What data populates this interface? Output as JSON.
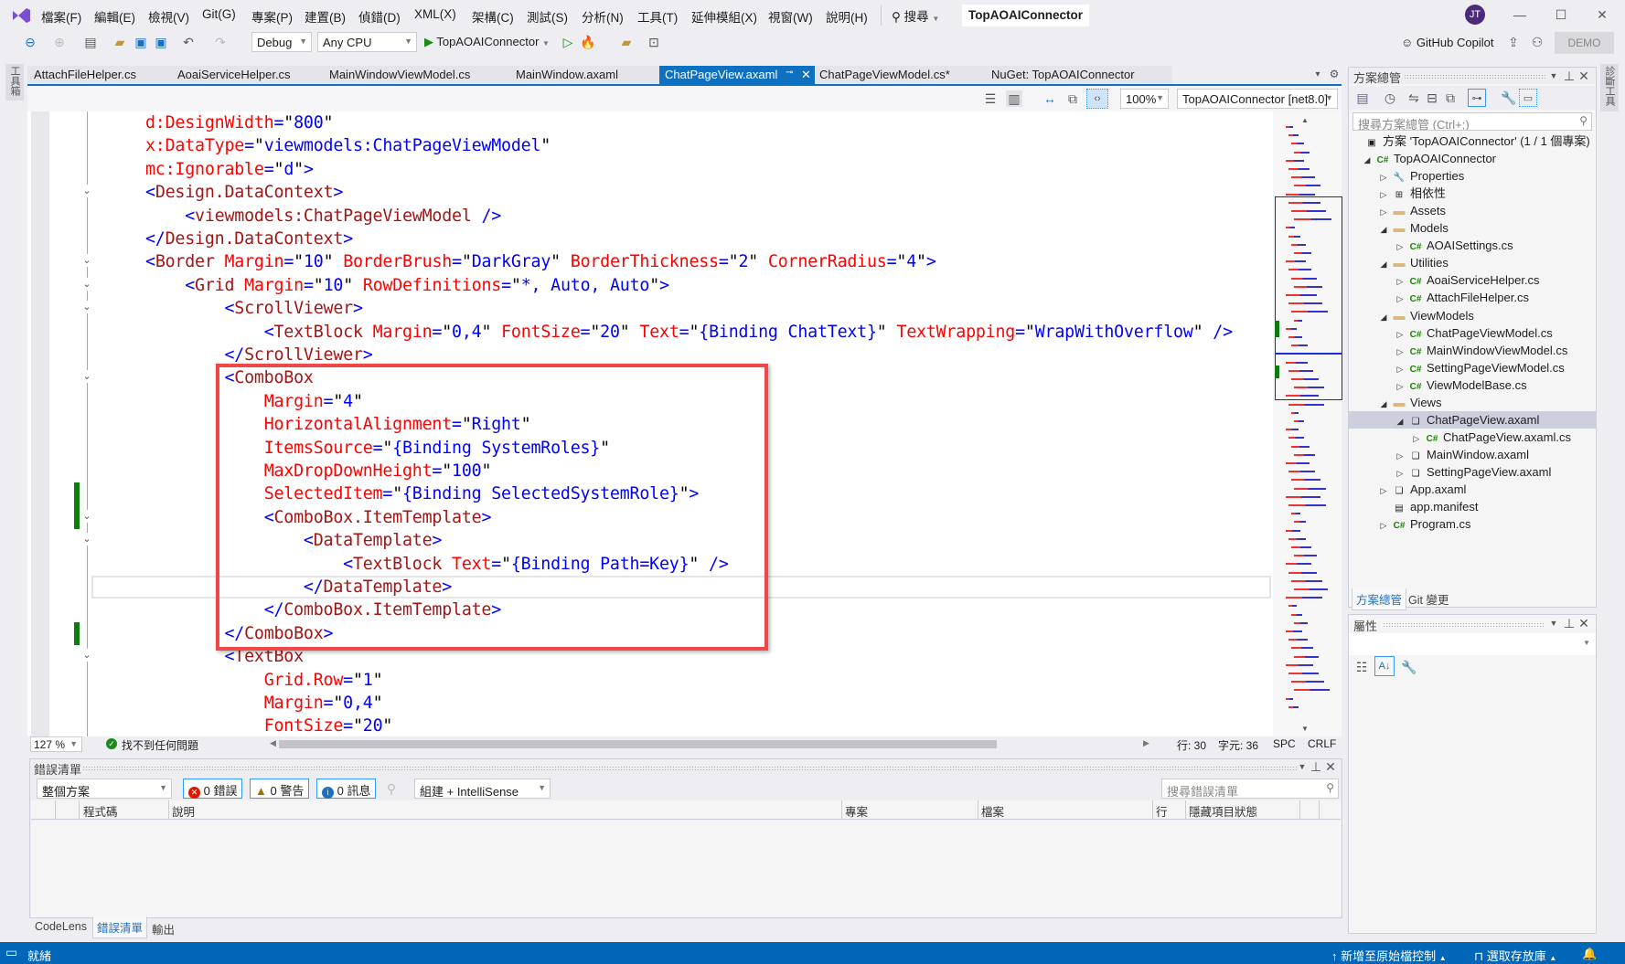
{
  "menu": {
    "items": [
      "檔案(F)",
      "編輯(E)",
      "檢視(V)",
      "Git(G)",
      "專案(P)",
      "建置(B)",
      "偵錯(D)",
      "XML(X)",
      "架構(C)",
      "測試(S)",
      "分析(N)",
      "工具(T)",
      "延伸模組(X)",
      "視窗(W)",
      "說明(H)"
    ],
    "search_label": "搜尋",
    "window_title": "TopAOAIConnector",
    "avatar_initials": "JT"
  },
  "toolbar": {
    "configuration": "Debug",
    "platform": "Any CPU",
    "startup_project": "TopAOAIConnector",
    "copilot_label": "GitHub Copilot",
    "demo_label": "DEMO"
  },
  "left_strip": {
    "label": "工具箱"
  },
  "right_strip": {
    "label": "診斷工具"
  },
  "tabs": [
    {
      "label": "AttachFileHelper.cs",
      "active": false
    },
    {
      "label": "AoaiServiceHelper.cs",
      "active": false
    },
    {
      "label": "MainWindowViewModel.cs",
      "active": false
    },
    {
      "label": "MainWindow.axaml",
      "active": false
    },
    {
      "label": "ChatPageView.axaml",
      "active": true
    },
    {
      "label": "ChatPageViewModel.cs*",
      "active": false
    },
    {
      "label": "NuGet: TopAOAIConnector",
      "active": false
    }
  ],
  "editor": {
    "zoom_select": "100%",
    "target_framework": "TopAOAIConnector [net8.0]",
    "lines": [
      {
        "text": "d:DesignWidth=\"800\""
      },
      {
        "text": "x:DataType=\"viewmodels:ChatPageViewModel\""
      },
      {
        "text": "mc:Ignorable=\"d\">"
      },
      {
        "text": "<Design.DataContext>",
        "fold": true
      },
      {
        "text": "    <viewmodels:ChatPageViewModel />"
      },
      {
        "text": "</Design.DataContext>"
      },
      {
        "text": "<Border Margin=\"10\" BorderBrush=\"DarkGray\" BorderThickness=\"2\" CornerRadius=\"4\">",
        "fold": true
      },
      {
        "text": "    <Grid Margin=\"10\" RowDefinitions=\"*, Auto, Auto\">",
        "fold": true
      },
      {
        "text": "        <ScrollViewer>",
        "fold": true
      },
      {
        "text": "            <TextBlock Margin=\"0,4\" FontSize=\"20\" Text=\"{Binding ChatText}\" TextWrapping=\"WrapWithOverflow\" />"
      },
      {
        "text": "        </ScrollViewer>"
      },
      {
        "text": "        <ComboBox",
        "fold": true
      },
      {
        "text": "            Margin=\"4\""
      },
      {
        "text": "            HorizontalAlignment=\"Right\""
      },
      {
        "text": "            ItemsSource=\"{Binding SystemRoles}\""
      },
      {
        "text": "            MaxDropDownHeight=\"100\""
      },
      {
        "text": "            SelectedItem=\"{Binding SelectedSystemRole}\">",
        "changed": true
      },
      {
        "text": "            <ComboBox.ItemTemplate>",
        "fold": true,
        "changed": true
      },
      {
        "text": "                <DataTemplate>",
        "fold": true
      },
      {
        "text": "                    <TextBlock Text=\"{Binding Path=Key}\" />"
      },
      {
        "text": "                </DataTemplate>",
        "current": true
      },
      {
        "text": "            </ComboBox.ItemTemplate>"
      },
      {
        "text": "        </ComboBox>",
        "changed": true
      },
      {
        "text": "        <TextBox",
        "fold": true
      },
      {
        "text": "            Grid.Row=\"1\""
      },
      {
        "text": "            Margin=\"0,4\""
      },
      {
        "text": "            FontSize=\"20\""
      }
    ],
    "status": {
      "zoom": "127 %",
      "issues": "找不到任何問題",
      "line": "行: 30",
      "char": "字元: 36",
      "spacing": "SPC",
      "eol": "CRLF"
    },
    "highlight_color": "#f04848"
  },
  "error_list": {
    "title": "錯誤清單",
    "scope": "整個方案",
    "errors": "0 錯誤",
    "warnings": "0 警告",
    "messages": "0 訊息",
    "source": "組建 + IntelliSense",
    "search_placeholder": "搜尋錯誤清單",
    "columns": [
      "程式碼",
      "說明",
      "專案",
      "檔案",
      "行",
      "隱藏項目狀態"
    ],
    "bottom_tabs": [
      "CodeLens",
      "錯誤清單",
      "輸出"
    ]
  },
  "solution_explorer": {
    "title": "方案總管",
    "search_placeholder": "搜尋方案總管 (Ctrl+;)",
    "items": [
      {
        "label": "方案 'TopAOAIConnector' (1 / 1 個專案)",
        "level": 0,
        "expander": "none",
        "icon": "solution-icon"
      },
      {
        "label": "TopAOAIConnector",
        "level": 1,
        "expander": "expanded",
        "icon": "csharp-project-icon"
      },
      {
        "label": "Properties",
        "level": 2,
        "expander": "collapsed",
        "icon": "properties-icon"
      },
      {
        "label": "相依性",
        "level": 2,
        "expander": "collapsed",
        "icon": "dependencies-icon"
      },
      {
        "label": "Assets",
        "level": 2,
        "expander": "collapsed",
        "icon": "folder-icon"
      },
      {
        "label": "Models",
        "level": 2,
        "expander": "expanded",
        "icon": "folder-icon"
      },
      {
        "label": "AOAISettings.cs",
        "level": 3,
        "expander": "collapsed",
        "icon": "csharp-file-icon"
      },
      {
        "label": "Utilities",
        "level": 2,
        "expander": "expanded",
        "icon": "folder-icon"
      },
      {
        "label": "AoaiServiceHelper.cs",
        "level": 3,
        "expander": "collapsed",
        "icon": "csharp-file-icon"
      },
      {
        "label": "AttachFileHelper.cs",
        "level": 3,
        "expander": "collapsed",
        "icon": "csharp-file-icon"
      },
      {
        "label": "ViewModels",
        "level": 2,
        "expander": "expanded",
        "icon": "folder-icon"
      },
      {
        "label": "ChatPageViewModel.cs",
        "level": 3,
        "expander": "collapsed",
        "icon": "csharp-file-icon"
      },
      {
        "label": "MainWindowViewModel.cs",
        "level": 3,
        "expander": "collapsed",
        "icon": "csharp-file-icon"
      },
      {
        "label": "SettingPageViewModel.cs",
        "level": 3,
        "expander": "collapsed",
        "icon": "csharp-file-icon"
      },
      {
        "label": "ViewModelBase.cs",
        "level": 3,
        "expander": "collapsed",
        "icon": "csharp-file-icon"
      },
      {
        "label": "Views",
        "level": 2,
        "expander": "expanded",
        "icon": "folder-icon"
      },
      {
        "label": "ChatPageView.axaml",
        "level": 3,
        "expander": "expanded",
        "icon": "axaml-file-icon",
        "selected": true
      },
      {
        "label": "ChatPageView.axaml.cs",
        "level": 4,
        "expander": "collapsed",
        "icon": "csharp-file-icon"
      },
      {
        "label": "MainWindow.axaml",
        "level": 3,
        "expander": "collapsed",
        "icon": "axaml-file-icon"
      },
      {
        "label": "SettingPageView.axaml",
        "level": 3,
        "expander": "collapsed",
        "icon": "axaml-file-icon"
      },
      {
        "label": "App.axaml",
        "level": 2,
        "expander": "collapsed",
        "icon": "axaml-file-icon"
      },
      {
        "label": "app.manifest",
        "level": 2,
        "expander": "none",
        "icon": "manifest-icon"
      },
      {
        "label": "Program.cs",
        "level": 2,
        "expander": "collapsed",
        "icon": "csharp-file-icon"
      }
    ],
    "bottom_tabs": [
      "方案總管",
      "Git 變更"
    ]
  },
  "properties": {
    "title": "屬性"
  },
  "status_bar": {
    "ready": "就緒",
    "add_source_control": "新增至原始檔控制",
    "select_repo": "選取存放庫"
  }
}
